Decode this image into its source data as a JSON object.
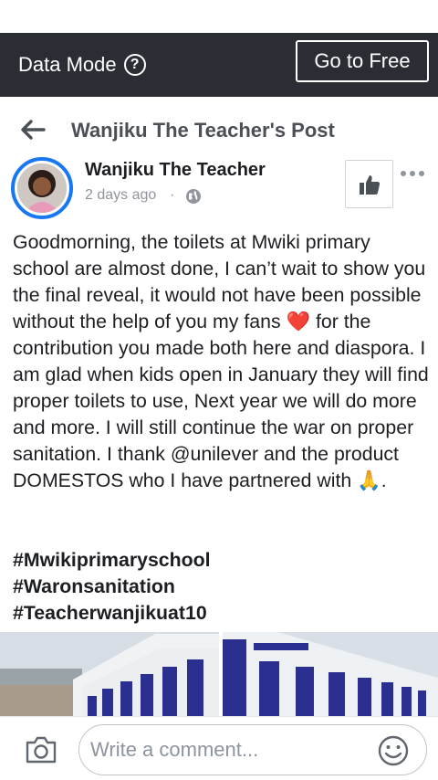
{
  "data_mode": {
    "label": "Data Mode",
    "info_icon": "info-icon",
    "go_free_label": "Go to Free",
    "bg_color": "#2a2d33"
  },
  "header": {
    "title": "Wanjiku The Teacher's Post",
    "back_icon": "arrow-left-icon"
  },
  "post": {
    "author": "Wanjiku The Teacher",
    "time": "2 days ago",
    "separator": "·",
    "privacy_icon": "globe-icon",
    "like_icon": "thumbs-up-icon",
    "more_icon": "more-horizontal-icon",
    "body_part1": "Goodmorning, the toilets at Mwiki primary school are almost done, I can’t wait to show you the final reveal, it would not have been possible without the help of you my fans ",
    "heart_emoji": "❤️",
    "body_part2": " for the contribution you made both here and diaspora. I am glad when kids open in January they will find proper toilets to use, Next year we will do more and more. I will still continue the war on proper sanitation. I thank @unilever and the product DOMESTOS who I have partnered with ",
    "pray_emoji": "🙏",
    "body_part3": ".",
    "hashtags": [
      "#Mwikiprimaryschool",
      "#Waronsanitation",
      "#Teacherwanjikuat10"
    ],
    "photos": [
      "photo-toilet-block-left",
      "photo-toilet-block-right"
    ]
  },
  "comment_bar": {
    "camera_icon": "camera-icon",
    "placeholder": "Write a comment...",
    "emoji_icon": "smiley-icon"
  },
  "colors": {
    "accent": "#1877f2",
    "text": "#1c1e21",
    "muted": "#90949c",
    "heart": "#e41e3f"
  }
}
